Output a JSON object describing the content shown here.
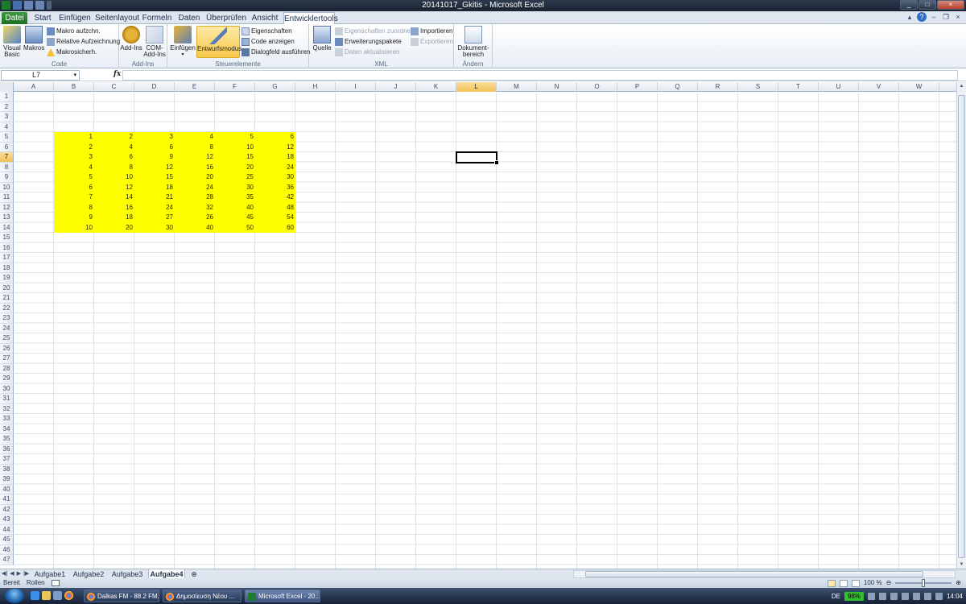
{
  "window": {
    "title": "20141017_Gkitis  -  Microsoft Excel",
    "controls": [
      "_",
      "□",
      "×"
    ]
  },
  "ribbon_tabs": [
    "Datei",
    "Start",
    "Einfügen",
    "Seitenlayout",
    "Formeln",
    "Daten",
    "Überprüfen",
    "Ansicht",
    "Entwicklertools"
  ],
  "active_tab": "Entwicklertools",
  "ribbon": {
    "code": {
      "label": "Code",
      "visual_basic": "Visual Basic",
      "makros": "Makros",
      "makro_aufzeichnen": "Makro aufzchn.",
      "relative_aufzeichnung": "Relative Aufzeichnung",
      "makrosicherheit": "Makrosicherh."
    },
    "addins": {
      "label": "Add-Ins",
      "add_ins": "Add-Ins",
      "com_add_ins": "COM-Add-Ins"
    },
    "steuerelemente": {
      "label": "Steuerelemente",
      "einfuegen": "Einfügen",
      "entwurfsmodus": "Entwurfsmodus",
      "eigenschaften": "Eigenschaften",
      "code_anzeigen": "Code anzeigen",
      "dialogfeld": "Dialogfeld ausführen"
    },
    "xml": {
      "label": "XML",
      "quelle": "Quelle",
      "eigenschaften_zuordnen": "Eigenschaften zuordnen",
      "erweiterungspakete": "Erweiterungspakete",
      "daten_aktualisieren": "Daten aktualisieren",
      "importieren": "Importieren",
      "exportieren": "Exportieren"
    },
    "aendern": {
      "label": "Ändern",
      "dokumentbereich": "Dokument-bereich"
    }
  },
  "formula_bar": {
    "name_box": "L7",
    "fx": "fx",
    "formula": ""
  },
  "grid": {
    "columns": [
      "A",
      "B",
      "C",
      "D",
      "E",
      "F",
      "G",
      "H",
      "I",
      "J",
      "K",
      "L",
      "M",
      "N",
      "O",
      "P",
      "Q",
      "R",
      "S",
      "T",
      "U",
      "V",
      "W"
    ],
    "row_count": 47,
    "selected_column": "L",
    "selected_row": 7,
    "highlight_color": "#ffff00",
    "data_start_row": 5,
    "data_start_column": "B",
    "table": [
      [
        1,
        2,
        3,
        4,
        5,
        6
      ],
      [
        2,
        4,
        6,
        8,
        10,
        12
      ],
      [
        3,
        6,
        9,
        12,
        15,
        18
      ],
      [
        4,
        8,
        12,
        16,
        20,
        24
      ],
      [
        5,
        10,
        15,
        20,
        25,
        30
      ],
      [
        6,
        12,
        18,
        24,
        30,
        36
      ],
      [
        7,
        14,
        21,
        28,
        35,
        42
      ],
      [
        8,
        16,
        24,
        32,
        40,
        48
      ],
      [
        9,
        18,
        27,
        26,
        45,
        54
      ],
      [
        10,
        20,
        30,
        40,
        50,
        60
      ]
    ]
  },
  "sheet_tabs": [
    "Aufgabe1",
    "Aufgabe2",
    "Aufgabe3",
    "Aufgabe4"
  ],
  "active_sheet": "Aufgabe4",
  "status_bar": {
    "mode": "Bereit",
    "scroll": "Rollen",
    "zoom": "100 %"
  },
  "taskbar": {
    "items": [
      "Dalkas FM - 88.2 FM...",
      "Δημοσίευση Νέου ...",
      "Microsoft Excel - 20..."
    ],
    "active_item": "Microsoft Excel - 20...",
    "language": "DE",
    "battery": "98%",
    "clock": "14:04"
  }
}
